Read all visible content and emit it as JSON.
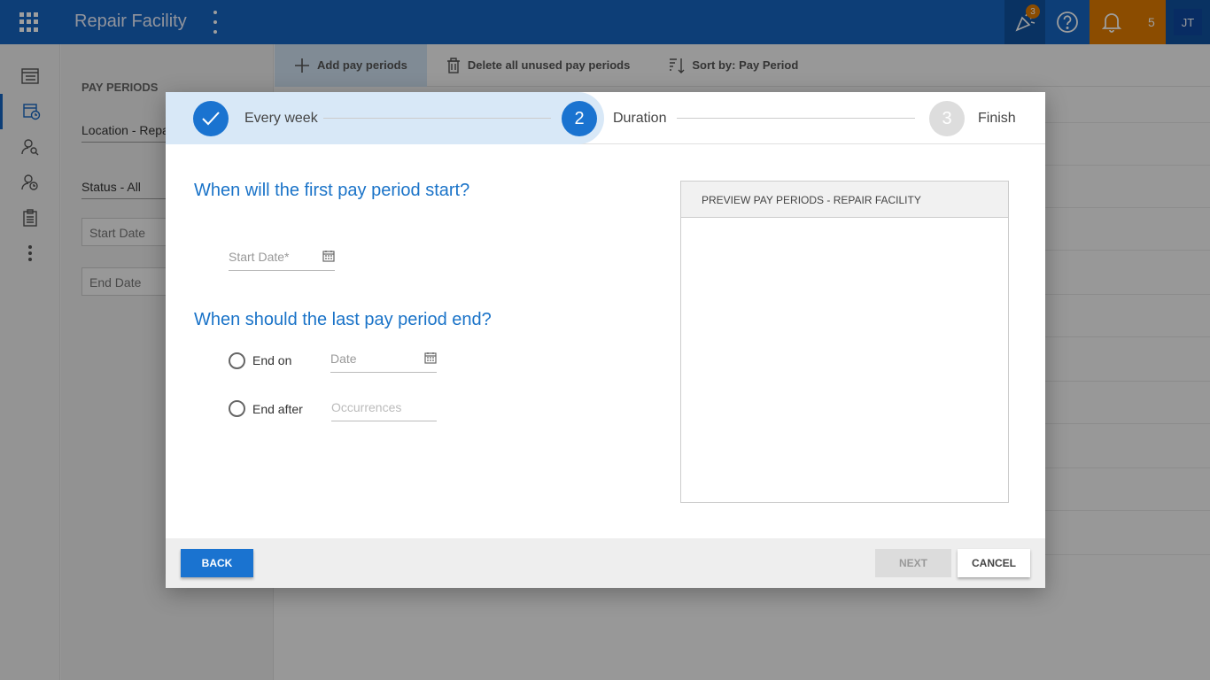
{
  "header": {
    "app_title": "Repair Facility",
    "celebration_badge": "3",
    "notification_count": "5",
    "user_initials": "JT"
  },
  "filter_panel": {
    "title": "PAY PERIODS",
    "location": "Location - Repa",
    "status": "Status - All",
    "start_date_placeholder": "Start Date",
    "end_date_placeholder": "End Date"
  },
  "toolbar": {
    "add_label": "Add pay periods",
    "delete_label": "Delete all unused pay periods",
    "sort_label": "Sort by: Pay Period"
  },
  "dialog": {
    "steps": [
      {
        "number": "1",
        "label": "Every week",
        "state": "complete"
      },
      {
        "number": "2",
        "label": "Duration",
        "state": "active"
      },
      {
        "number": "3",
        "label": "Finish",
        "state": "pending"
      }
    ],
    "question_start": "When will the first pay period start?",
    "start_date_placeholder": "Start Date*",
    "question_end": "When should the last pay period end?",
    "end_on_label": "End on",
    "end_on_placeholder": "Date",
    "end_after_label": "End after",
    "end_after_placeholder": "Occurrences",
    "preview_title": "PREVIEW PAY PERIODS - REPAIR FACILITY",
    "back_label": "BACK",
    "next_label": "NEXT",
    "cancel_label": "CANCEL"
  },
  "colors": {
    "primary": "#1565c0",
    "accent": "#e07b00",
    "question": "#1a73c8"
  }
}
